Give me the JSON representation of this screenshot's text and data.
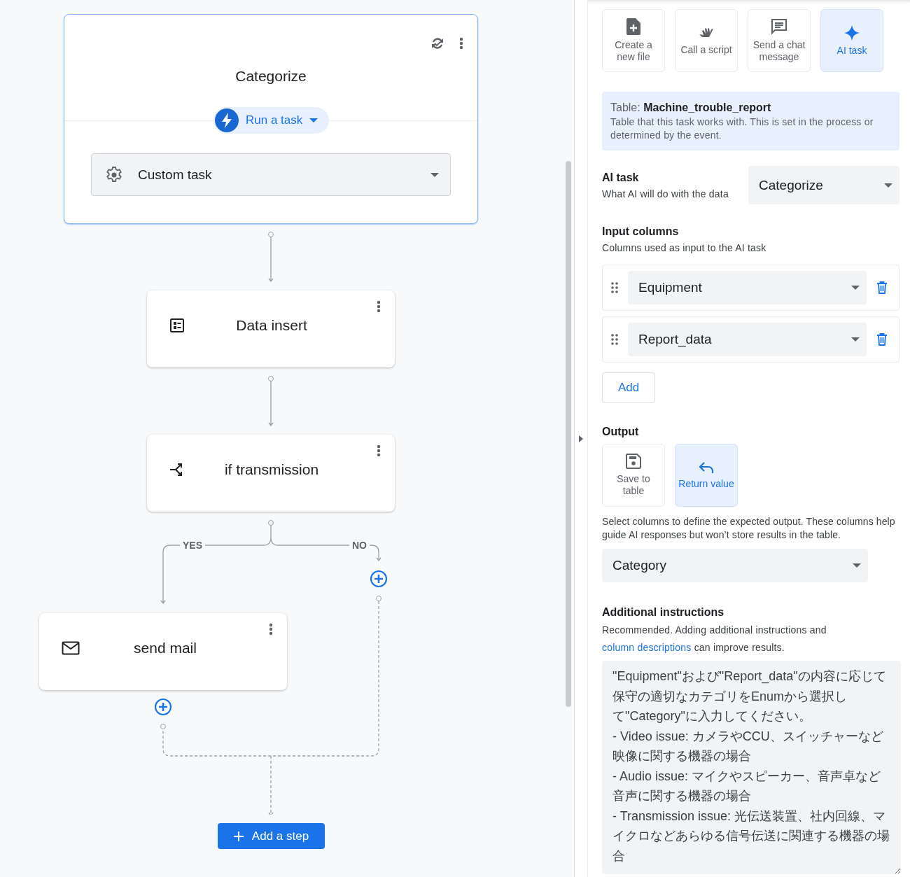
{
  "canvas": {
    "trigger_card": {
      "title": "Categorize",
      "action": "Run a task",
      "task": "Custom task"
    },
    "steps": [
      {
        "kind": "table",
        "title": "Data insert"
      },
      {
        "kind": "branch",
        "title": "if transmission"
      },
      {
        "kind": "mail",
        "title": "send mail"
      }
    ],
    "branch_labels": [
      "YES",
      "NO"
    ],
    "add_step": "Add a step"
  },
  "panel": {
    "step_types": [
      {
        "kind": "file",
        "label": "Create a new file",
        "selected": false
      },
      {
        "kind": "script",
        "label": "Call a script",
        "selected": false
      },
      {
        "kind": "chat",
        "label": "Send a chat message",
        "selected": false
      },
      {
        "kind": "ai",
        "label": "AI task",
        "selected": true
      }
    ],
    "table_info": {
      "label": "Table:",
      "name": "Machine_trouble_report",
      "description": "Table that this task works with. This is set in the process or determined by the event."
    },
    "ai_task": {
      "title": "AI task",
      "description": "What AI will do with the data",
      "value": "Categorize"
    },
    "input_columns": {
      "title": "Input columns",
      "description": "Columns used as input to the AI task",
      "columns": [
        "Equipment",
        "Report_data"
      ],
      "add": "Add"
    },
    "output": {
      "title": "Output",
      "options": [
        {
          "kind": "save",
          "label": "Save to table",
          "selected": false
        },
        {
          "kind": "return",
          "label": "Return value",
          "selected": true
        }
      ],
      "description": "Select columns to define the expected output. These columns help guide AI responses but won’t store results in the table.",
      "value": "Category"
    },
    "instructions": {
      "title": "Additional instructions",
      "text_before": "Recommended. Adding additional instructions and",
      "link": "column descriptions",
      "text_after": "can improve results.",
      "value": "\"Equipment\"および\"Report_data\"の内容に応じて保守の適切なカテゴリをEnumから選択して\"Category\"に入力してください。\n- Video issue: カメラやCCU、スイッチャーなど映像に関する機器の場合\n- Audio issue: マイクやスピーカー、音声卓など音声に関する機器の場合\n- Transmission issue: 光伝送装置、社内回線、マイクロなどあらゆる信号伝送に関連する機器の場合"
    }
  }
}
